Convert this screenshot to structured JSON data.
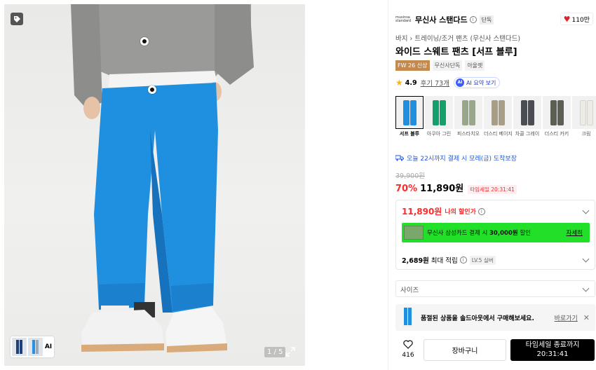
{
  "gallery": {
    "counter": "1 / 5",
    "ai_label": "AI",
    "model_colors": {
      "sweater": "#9a9a98",
      "shirt": "#f4f4f4",
      "pants": "#1f8fe0",
      "pants_shade": "#1672bd",
      "sneakers": "#f2f2f2",
      "sole": "#d9aa7a"
    }
  },
  "brand": {
    "logo_text": "musinsa standard",
    "name": "무신사 스탠다드",
    "info_icon": "info-icon",
    "exclusive": "단독",
    "likes": "110만"
  },
  "breadcrumb": [
    "바지",
    "트레이닝/조거 팬츠 (무신사 스탠다드)"
  ],
  "title": "와이드 스웨트 팬츠 [서프 블루]",
  "badges": [
    "FW 26 신상",
    "무신사단독",
    "아울렛"
  ],
  "rating": {
    "score": "4.9",
    "reviews": "후기 73개",
    "ai_summary": "AI 요약 보기"
  },
  "colors": [
    {
      "label": "서프 블루",
      "hex": "#1f8fe0",
      "selected": true
    },
    {
      "label": "아쿠아 그린",
      "hex": "#14a06b",
      "selected": false
    },
    {
      "label": "피스타치오",
      "hex": "#9aa68a",
      "selected": false
    },
    {
      "label": "더스티 베이지",
      "hex": "#a89e86",
      "selected": false
    },
    {
      "label": "차콜 그레이",
      "hex": "#4a4d52",
      "selected": false
    },
    {
      "label": "더스티 카키",
      "hex": "#5b5e52",
      "selected": false
    },
    {
      "label": "크림",
      "hex": "#ecebe4",
      "selected": false
    }
  ],
  "delivery": "오늘 22시까지 결제 시 모레(금) 도착보장",
  "price": {
    "original": "39,900원",
    "discount": "70%",
    "final": "11,890원",
    "timer_badge": "타임세일 20:31:41"
  },
  "benefits": {
    "my_price": "11,890원",
    "my_label": "나의 할인가",
    "card_text_pre": "무신사 삼성카드 결제 시 ",
    "card_text_bold": "30,000원",
    "card_text_post": " 할인",
    "card_more": "자세히",
    "points": "2,689원",
    "points_label": "최대 적립",
    "level": "LV.5 실버"
  },
  "size": {
    "placeholder": "사이즈"
  },
  "soldout": {
    "text": "품절된 상품을 솔드아웃에서 구매해보세요.",
    "link": "바로가기",
    "close": "✕"
  },
  "bottom": {
    "like_count": "416",
    "cart": "장바구니",
    "buy_line1": "타임세일 종료까지",
    "buy_line2": "20:31:41"
  }
}
